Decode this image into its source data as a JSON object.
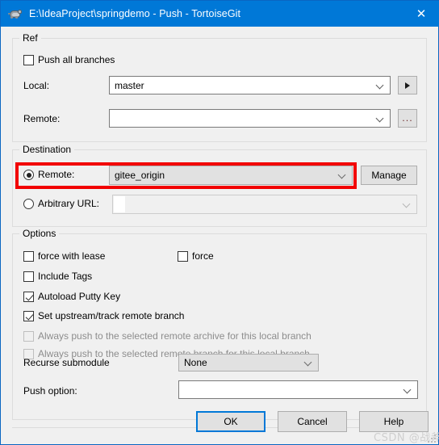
{
  "window": {
    "title": "E:\\IdeaProject\\springdemo - Push - TortoiseGit",
    "app_icon": "tortoisegit-turtle-icon",
    "close_label": "✕",
    "titlebar_color": "#0078d7"
  },
  "ref_group": {
    "legend": "Ref",
    "push_all_branches": {
      "label": "Push all branches",
      "checked": false
    },
    "local": {
      "label": "Local:",
      "value": "master",
      "placeholder": ""
    },
    "local_button": {
      "icon": "play-triangle-icon",
      "label": "▶"
    },
    "remote": {
      "label": "Remote:",
      "value": "",
      "placeholder": ""
    },
    "remote_button": {
      "icon": "ellipsis-icon",
      "label": "..."
    }
  },
  "destination_group": {
    "legend": "Destination",
    "remote_radio": {
      "label": "Remote:",
      "selected": true
    },
    "remote_combo": {
      "value": "gitee_origin"
    },
    "manage_button": {
      "label": "Manage"
    },
    "arbitrary_radio": {
      "label": "Arbitrary URL:",
      "selected": false
    },
    "arbitrary_combo": {
      "value": "",
      "placeholder": ""
    },
    "annotation": {
      "color": "#f20000",
      "shape": "rectangle"
    }
  },
  "options_group": {
    "legend": "Options",
    "checkboxes": [
      {
        "label": "force with lease",
        "checked": false,
        "enabled": true
      },
      {
        "label": "force",
        "checked": false,
        "enabled": true
      },
      {
        "label": "Include Tags",
        "checked": false,
        "enabled": true
      },
      {
        "label": "Autoload Putty Key",
        "checked": true,
        "enabled": true
      },
      {
        "label": "Set upstream/track remote branch",
        "checked": true,
        "enabled": true
      },
      {
        "label": "Always push to the selected remote archive for this local branch",
        "checked": false,
        "enabled": false
      },
      {
        "label": "Always push to the selected remote branch for this local branch",
        "checked": false,
        "enabled": false
      }
    ],
    "recurse_submodule": {
      "label": "Recurse submodule",
      "value": "None"
    },
    "push_option": {
      "label": "Push option:",
      "value": "",
      "placeholder": ""
    }
  },
  "footer": {
    "ok_button": {
      "label": "OK",
      "default": true
    },
    "cancel_button": {
      "label": "Cancel"
    },
    "help_button": {
      "label": "Help"
    }
  },
  "watermark": {
    "text": "CSDN @战斧"
  }
}
